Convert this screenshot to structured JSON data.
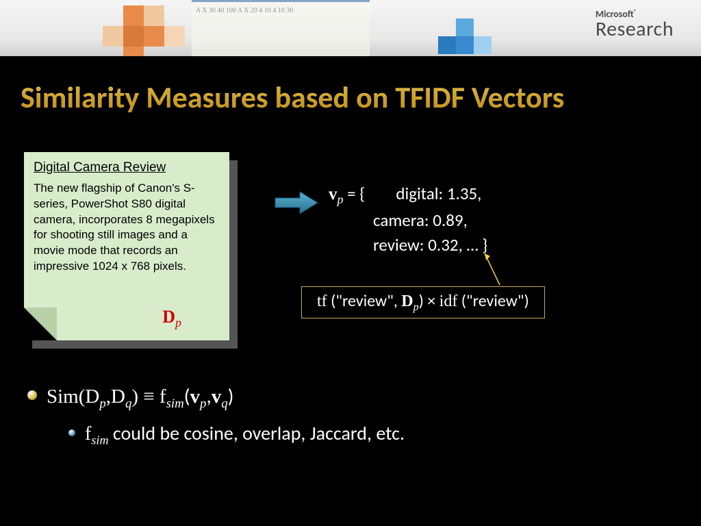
{
  "header": {
    "brand_top": "Microsoft",
    "brand_bottom": "Research",
    "whiteboard_text": "A  X  30  40  100\nA  X  20  4  10\n      4    10    30"
  },
  "title": "Similarity Measures based on TFIDF Vectors",
  "sticky": {
    "heading": "Digital Camera Review",
    "body": "The new flagship of Canon's S-series, PowerShot S80 digital camera, incorporates 8 megapixels for shooting still images and a movie mode that records an impressive 1024 x 768 pixels.",
    "doc_symbol": "D",
    "doc_sub": "p"
  },
  "vector": {
    "symbol": "v",
    "sub": "p",
    "open": " = {",
    "entry1": "digital: 1.35,",
    "entry2": "camera: 0.89,",
    "entry3": "review: 0.32, … }"
  },
  "formula": {
    "tf": "tf",
    "open1": " (\"review\", ",
    "D": "D",
    "Dsub": "p",
    "mid": ") × ",
    "idf": "idf",
    "open2": " (\"review\")"
  },
  "bullets": {
    "line1_a": "Sim(D",
    "line1_b": ",D",
    "line1_c": ") ≡ f",
    "line1_d": "(",
    "line1_e": ",",
    "line1_f": ")",
    "line2_a": "f",
    "line2_b": " could be cosine, overlap, Jaccard, etc.",
    "sub_p": "p",
    "sub_q": "q",
    "sub_sim": "sim",
    "v": "v"
  }
}
